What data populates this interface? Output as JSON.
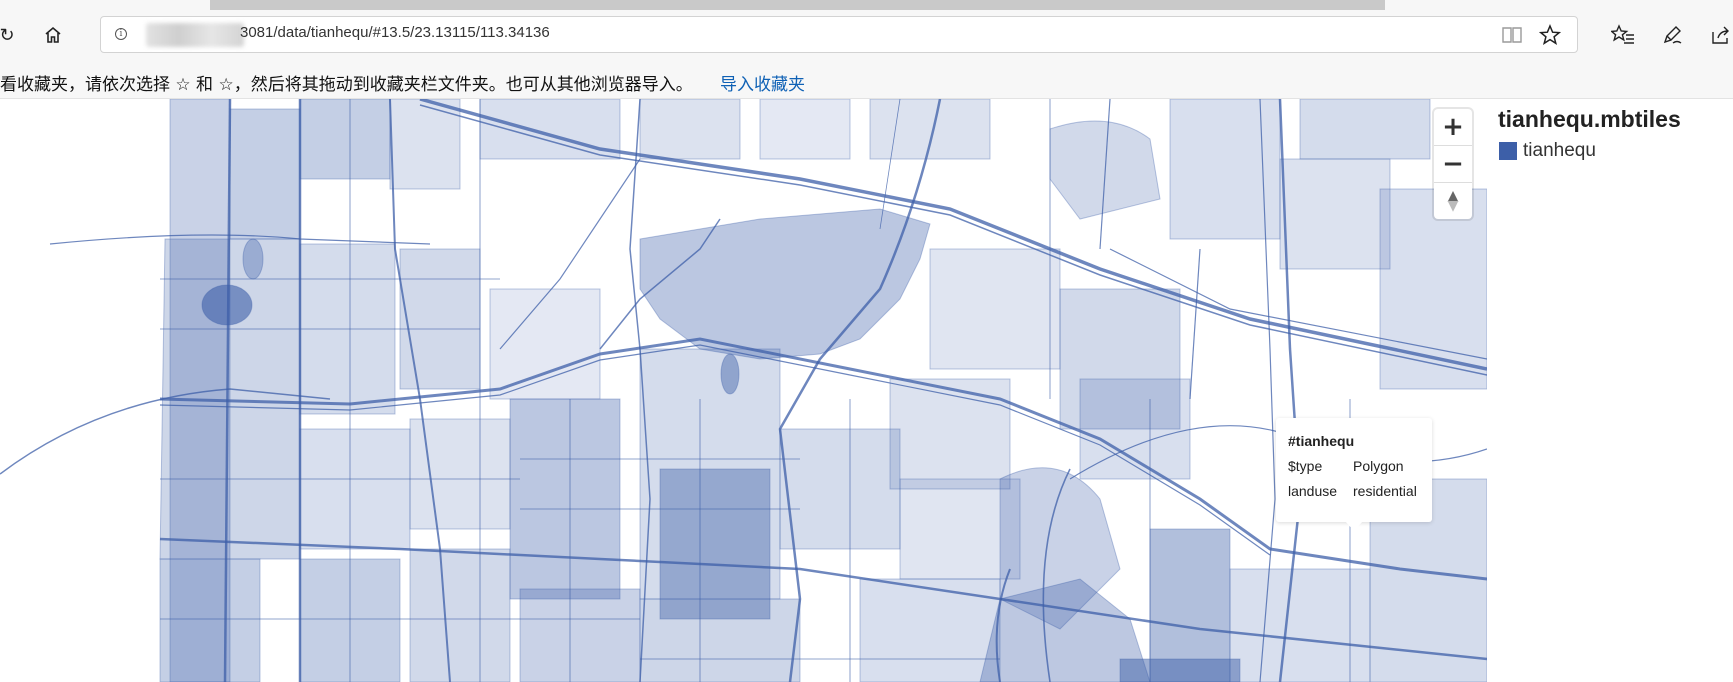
{
  "browser": {
    "url_suffix": "3081/data/tianhequ/#13.5/23.13115/113.34136",
    "info_glyph": "i",
    "refresh_glyph": "↻",
    "home_glyph": "⌂",
    "favorites_message": "看收藏夹，请依次选择 ☆ 和 ☆，然后将其拖动到收藏夹栏文件夹。也可从其他浏览器导入。",
    "import_favorites_label": "导入收藏夹"
  },
  "map": {
    "fill_color": "#3d5fa8",
    "zoom_in": "+",
    "zoom_out": "−",
    "compass": "▲"
  },
  "popup": {
    "title": "#tianhequ",
    "rows": [
      {
        "key": "$type",
        "value": "Polygon"
      },
      {
        "key": "landuse",
        "value": "residential"
      }
    ]
  },
  "legend": {
    "title": "tianhequ.mbtiles",
    "layers": [
      {
        "name": "tianhequ",
        "color": "#3d5fa8"
      }
    ]
  }
}
